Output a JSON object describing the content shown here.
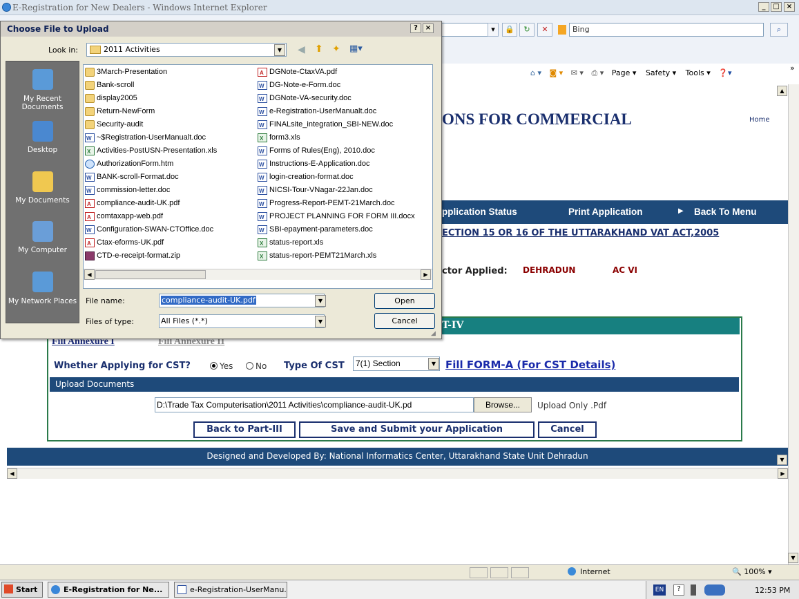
{
  "browser": {
    "title": "E-Registration for New Dealers - Windows Internet Explorer",
    "search_placeholder": "Bing",
    "command_items": [
      "Page ▾",
      "Safety ▾",
      "Tools ▾"
    ]
  },
  "page": {
    "site_title": "ONS FOR COMMERCIAL",
    "home_link": "Home",
    "menu": [
      "pplication Status",
      "Print Application",
      "Back To Menu"
    ],
    "section_heading": "ECTION 15 OR 16 OF THE UTTARAKHAND VAT ACT,2005",
    "sector_label": "ctor Applied:",
    "sector_values": [
      "DEHRADUN",
      "AC VI"
    ],
    "part_header": "T-IV",
    "annexure_1": "Fill Annexure I",
    "annexure_2": "Fill Annexure II",
    "cst_question": "Whether Applying for CST?",
    "cst_yes": "Yes",
    "cst_no": "No",
    "cst_selected": "Yes",
    "type_cst_label": "Type Of CST",
    "type_cst_value": "7(1) Section",
    "forma_link": "Fill FORM-A (For CST Details)",
    "upload_header": "Upload Documents",
    "upload_path": "D:\\Trade Tax Computerisation\\2011 Activities\\compliance-audit-UK.pd",
    "browse_label": "Browse...",
    "upload_note": "Upload Only .Pdf",
    "buttons": [
      "Back to Part-III",
      "Save and Submit your Application",
      "Cancel"
    ],
    "footer": "Designed and Developed By: National Informatics Center, Uttarakhand State Unit Dehradun"
  },
  "status_bar": {
    "zone": "Internet",
    "zoom": "100%"
  },
  "taskbar": {
    "start": "Start",
    "tasks": [
      "E-Registration for Ne...",
      "e-Registration-UserManu..."
    ],
    "lang": "EN",
    "clock": "12:53 PM"
  },
  "dialog": {
    "title": "Choose File to Upload",
    "look_in_label": "Look in:",
    "look_in_value": "2011 Activities",
    "places": [
      "My Recent Documents",
      "Desktop",
      "My Documents",
      "My Computer",
      "My Network Places"
    ],
    "files_col1": [
      {
        "name": "3March-Presentation",
        "type": "folder"
      },
      {
        "name": "Bank-scroll",
        "type": "folder"
      },
      {
        "name": "display2005",
        "type": "folder"
      },
      {
        "name": "Return-NewForm",
        "type": "folder"
      },
      {
        "name": "Security-audit",
        "type": "folder"
      },
      {
        "name": "~$Registration-UserManualt.doc",
        "type": "word"
      },
      {
        "name": "Activities-PostUSN-Presentation.xls",
        "type": "xls"
      },
      {
        "name": "AuthorizationForm.htm",
        "type": "htm"
      },
      {
        "name": "BANK-scroll-Format.doc",
        "type": "word"
      },
      {
        "name": "commission-letter.doc",
        "type": "word"
      },
      {
        "name": "compliance-audit-UK.pdf",
        "type": "pdf"
      },
      {
        "name": "comtaxapp-web.pdf",
        "type": "pdf"
      },
      {
        "name": "Configuration-SWAN-CTOffice.doc",
        "type": "word"
      },
      {
        "name": "Ctax-eforms-UK.pdf",
        "type": "pdf"
      },
      {
        "name": "CTD-e-receipt-format.zip",
        "type": "zip"
      }
    ],
    "files_col2": [
      {
        "name": "DGNote-CtaxVA.pdf",
        "type": "pdf"
      },
      {
        "name": "DG-Note-e-Form.doc",
        "type": "word"
      },
      {
        "name": "DGNote-VA-security.doc",
        "type": "word"
      },
      {
        "name": "e-Registration-UserManualt.doc",
        "type": "word"
      },
      {
        "name": "FINALsite_integration_SBI-NEW.doc",
        "type": "word"
      },
      {
        "name": "form3.xls",
        "type": "xls"
      },
      {
        "name": "Forms of Rules(Eng), 2010.doc",
        "type": "word"
      },
      {
        "name": "Instructions-E-Application.doc",
        "type": "word"
      },
      {
        "name": "login-creation-format.doc",
        "type": "word"
      },
      {
        "name": "NICSI-Tour-VNagar-22Jan.doc",
        "type": "word"
      },
      {
        "name": "Progress-Report-PEMT-21March.doc",
        "type": "word"
      },
      {
        "name": "PROJECT PLANNING FOR FORM III.docx",
        "type": "word"
      },
      {
        "name": "SBI-epayment-parameters.doc",
        "type": "word"
      },
      {
        "name": "status-report.xls",
        "type": "xls"
      },
      {
        "name": "status-report-PEMT21March.xls",
        "type": "xls"
      }
    ],
    "file_name_label": "File name:",
    "file_name_value": "compliance-audit-UK.pdf",
    "files_of_type_label": "Files of type:",
    "files_of_type_value": "All Files (*.*)",
    "open_label": "Open",
    "cancel_label": "Cancel"
  }
}
